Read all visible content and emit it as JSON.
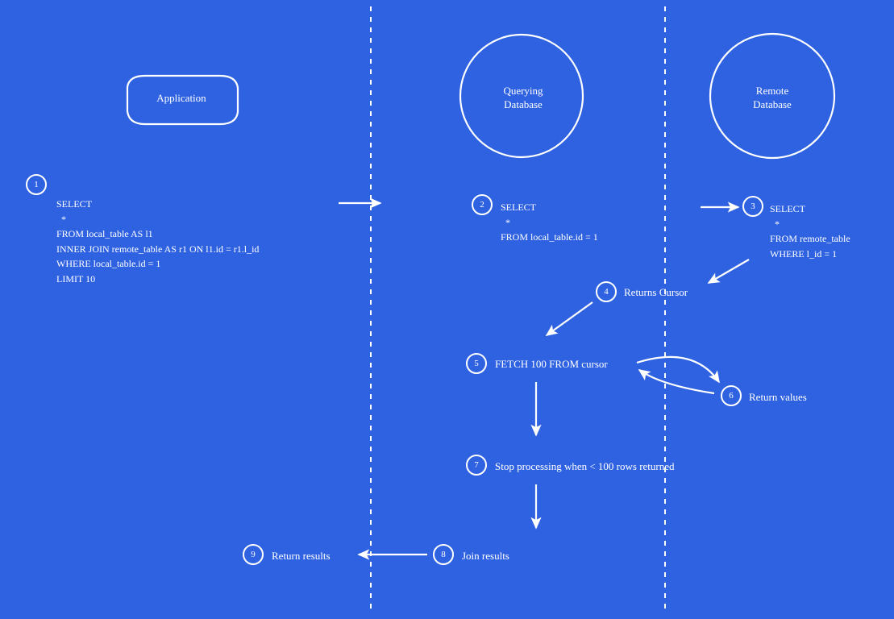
{
  "lanes": {
    "app": {
      "title": "Application"
    },
    "query": {
      "title": "Querying\nDatabase"
    },
    "remote": {
      "title": "Remote\nDatabase"
    }
  },
  "steps": {
    "s1": {
      "num": "1",
      "code": "SELECT\n  *\nFROM local_table AS l1\nINNER JOIN remote_table AS r1 ON l1.id = r1.l_id\nWHERE local_table.id = 1\nLIMIT 10"
    },
    "s2": {
      "num": "2",
      "code": "SELECT\n  *\nFROM local_table.id = 1"
    },
    "s3": {
      "num": "3",
      "code": "SELECT\n  *\nFROM remote_table\nWHERE l_id = 1"
    },
    "s4": {
      "num": "4",
      "label": "Returns Cursor"
    },
    "s5": {
      "num": "5",
      "label": "FETCH 100 FROM cursor"
    },
    "s6": {
      "num": "6",
      "label": "Return values"
    },
    "s7": {
      "num": "7",
      "label": "Stop processing when < 100 rows returned"
    },
    "s8": {
      "num": "8",
      "label": "Join results"
    },
    "s9": {
      "num": "9",
      "label": "Return results"
    }
  }
}
